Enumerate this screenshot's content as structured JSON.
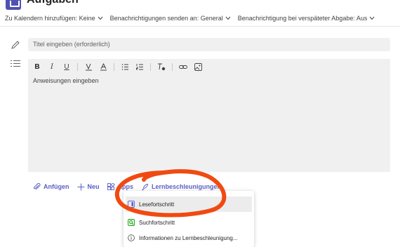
{
  "header": {
    "title": "Aufgaben"
  },
  "options": [
    {
      "label": "Zu Kalendern hinzufügen: Keine"
    },
    {
      "label": "Benachrichtigungen senden an: General"
    },
    {
      "label": "Benachrichtigung bei verspäteter Abgabe: Aus"
    }
  ],
  "title_field": {
    "placeholder": "Titel eingeben (erforderlich)"
  },
  "toolbar": {
    "bold": "B",
    "italic": "I",
    "underline": "U"
  },
  "editor": {
    "placeholder": "Anweisungen eingeben"
  },
  "actions": {
    "attach": "Anfügen",
    "new": "Neu",
    "apps": "Apps",
    "learning": "Lernbeschleunigungen"
  },
  "menu": {
    "items": [
      {
        "label": "Lesefortschritt"
      },
      {
        "label": "Suchfortschritt"
      },
      {
        "label": "Informationen zu Lernbeschleunigung..."
      }
    ]
  },
  "colors": {
    "accent": "#5b5fc7",
    "annotation": "#f04a12"
  }
}
